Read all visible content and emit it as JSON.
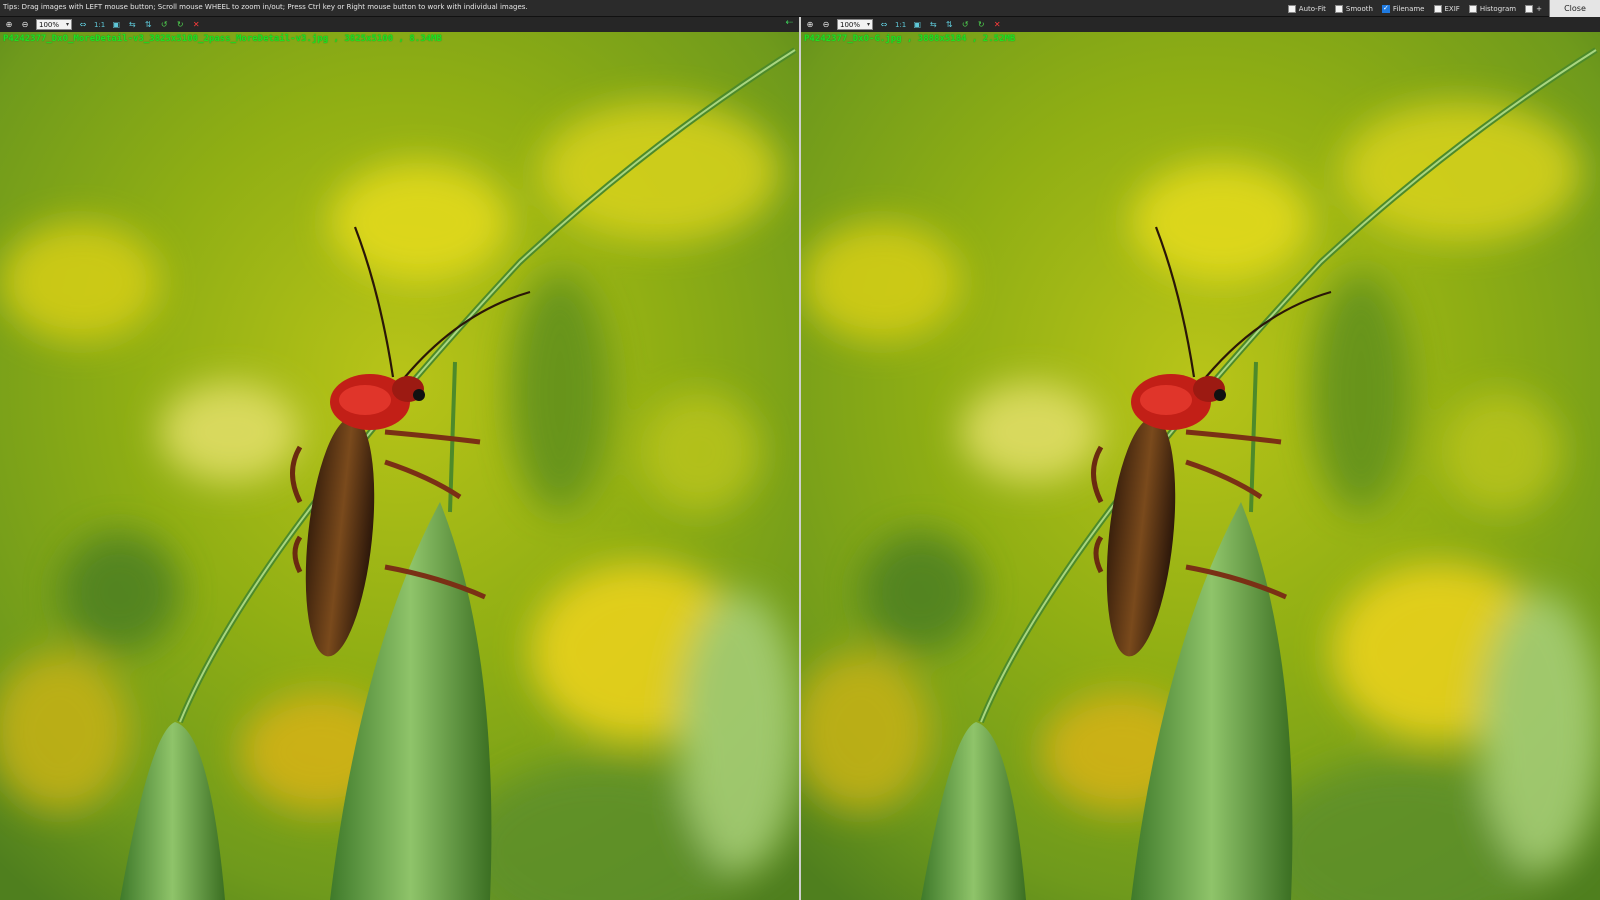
{
  "tips": "Tips: Drag images with LEFT mouse button; Scroll mouse WHEEL to zoom in/out; Press Ctrl key or Right mouse button to work with individual images.",
  "options": [
    {
      "label": "Auto-Fit",
      "checked": false
    },
    {
      "label": "Smooth",
      "checked": false
    },
    {
      "label": "Filename",
      "checked": true
    },
    {
      "label": "EXIF",
      "checked": false
    },
    {
      "label": "Histogram",
      "checked": false
    },
    {
      "label": "+",
      "checked": false
    }
  ],
  "close_label": "Close",
  "panels": {
    "left": {
      "zoom": "100%",
      "one_to_one": "1:1",
      "caption": "P4242377_DxO_MoreDetail-v3_3825x5100_2pass_MoreDetail-v3.jpg , 3825x5100 , 8.34MB"
    },
    "right": {
      "zoom": "100%",
      "one_to_one": "1:1",
      "caption": "P4242377_DxO-G.jpg , 3888x5184 , 2.52MB"
    }
  },
  "icons": {
    "zoom_in": "zoom-in-icon",
    "zoom_out": "zoom-out-icon",
    "fit": "fit-window-icon",
    "rotate": "rotate-icon",
    "flip": "flip-icon",
    "remove": "close-icon",
    "sync": "sync-arrow-icon"
  },
  "colors": {
    "caption": "#22e01e",
    "checkbox_checked": "#1f7ae0",
    "remove": "#ff3b3b",
    "tool": "#5fc8d8"
  }
}
